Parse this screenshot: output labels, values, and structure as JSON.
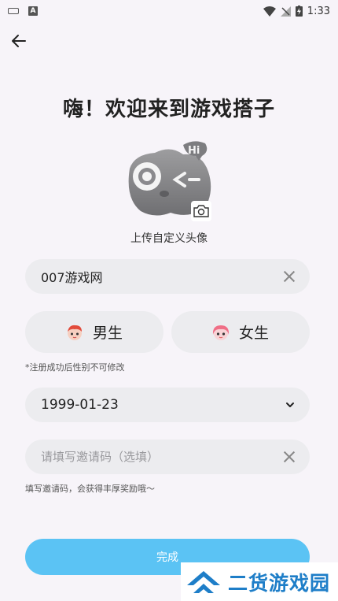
{
  "status_bar": {
    "time": "1:33",
    "notification_icons": [
      "keyboard-icon",
      "a-icon"
    ],
    "system_icons": [
      "wifi-icon",
      "no-signal-icon",
      "battery-charging-icon"
    ]
  },
  "header": {
    "back_icon": "arrow-left-icon",
    "title": "嗨！欢迎来到游戏搭子"
  },
  "avatar": {
    "caption": "上传自定义头像",
    "badge_icon": "camera-icon",
    "bubble_text": "Hi"
  },
  "form": {
    "nickname": {
      "value": "007游戏网",
      "clear_icon": "clear-icon"
    },
    "gender": {
      "male_label": "男生",
      "female_label": "女生",
      "note": "*注册成功后性别不可修改"
    },
    "birthday": {
      "value": "1999-01-23",
      "dropdown_icon": "chevron-down-icon"
    },
    "invite": {
      "placeholder": "请填写邀请码（选填）",
      "clear_icon": "clear-icon",
      "note": "填写邀请码，会获得丰厚奖励哦～"
    },
    "submit_label": "完成"
  },
  "watermark": {
    "text": "二货游戏园"
  },
  "colors": {
    "background": "#f7f4f9",
    "field_bg": "#ececef",
    "primary": "#5bc3f4",
    "watermark": "#1e7ec8"
  }
}
